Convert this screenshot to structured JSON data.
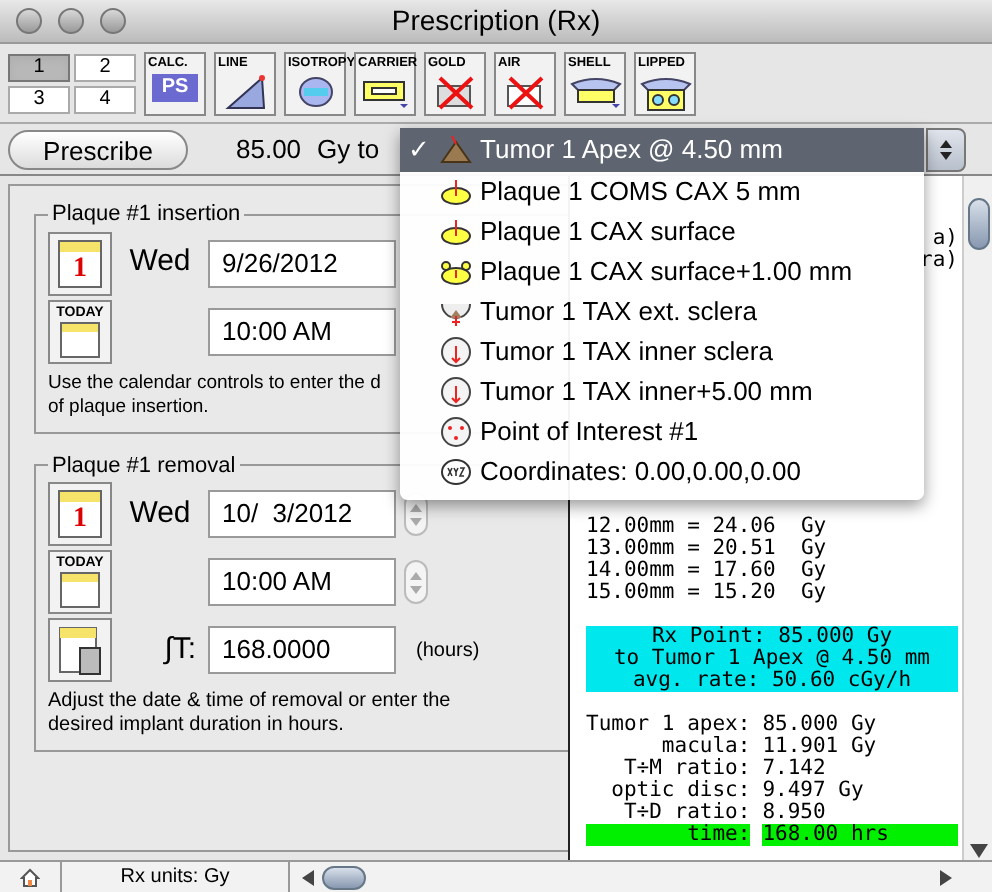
{
  "window": {
    "title": "Prescription (Rx)"
  },
  "toolbar": {
    "views": [
      {
        "label": "1",
        "selected": true
      },
      {
        "label": "2",
        "selected": false
      },
      {
        "label": "3",
        "selected": false
      },
      {
        "label": "4",
        "selected": false
      }
    ],
    "tools": [
      {
        "label": "CALC.",
        "kind": "calc",
        "badge": "PS"
      },
      {
        "label": "LINE",
        "kind": "line"
      },
      {
        "label": "ISOTROPY",
        "kind": "isotropy"
      },
      {
        "label": "CARRIER",
        "kind": "carrier"
      },
      {
        "label": "GOLD",
        "kind": "gold"
      },
      {
        "label": "AIR",
        "kind": "air"
      },
      {
        "label": "SHELL",
        "kind": "shell"
      },
      {
        "label": "LIPPED",
        "kind": "lipped"
      }
    ]
  },
  "prescribe": {
    "button": "Prescribe",
    "dose": "85.00",
    "unit": "Gy to",
    "check_mark": "✓",
    "menu": [
      {
        "label": "Tumor 1 Apex @ 4.50 mm",
        "kind": "tumor",
        "selected": true
      },
      {
        "label": "Plaque 1 COMS CAX 5 mm",
        "kind": "plaque",
        "selected": false
      },
      {
        "label": "Plaque 1 CAX surface",
        "kind": "plaque",
        "selected": false
      },
      {
        "label": "Plaque 1 CAX surface+1.00 mm",
        "kind": "plaque-ears",
        "selected": false
      },
      {
        "label": "Tumor 1 TAX ext. sclera",
        "kind": "sclera",
        "selected": false
      },
      {
        "label": "Tumor 1 TAX inner sclera",
        "kind": "inner",
        "selected": false
      },
      {
        "label": "Tumor 1 TAX inner+5.00 mm",
        "kind": "inner",
        "selected": false
      },
      {
        "label": "Point of Interest #1",
        "kind": "poi",
        "selected": false
      },
      {
        "label": "Coordinates: 0.00,0.00,0.00",
        "kind": "xyz",
        "selected": false
      }
    ]
  },
  "insertion": {
    "title": "Plaque #1 insertion",
    "day": "Wed",
    "date": "9/26/2012",
    "time": "10:00 AM",
    "today": "TODAY",
    "calendar_day": "1",
    "note": "Use the calendar controls to enter the d\nof plaque insertion."
  },
  "removal": {
    "title": "Plaque #1 removal",
    "day": "Wed",
    "date": "10/  3/2012",
    "time": "10:00 AM",
    "today": "TODAY",
    "calendar_day": "1",
    "jt_label": "∫T:",
    "duration": "168.0000",
    "duration_unit": "(hours)",
    "note": "Adjust the date & time of removal or enter the\ndesired implant duration in hours."
  },
  "report": {
    "fragments": [
      "a)",
      "ra)"
    ],
    "dose_lines": [
      "12.00mm = 24.06  Gy",
      "13.00mm = 20.51  Gy",
      "14.00mm = 17.60  Gy",
      "15.00mm = 15.20  Gy"
    ],
    "rx_block": [
      "Rx Point: 85.000 Gy",
      "to Tumor 1 Apex @ 4.50 mm",
      "avg. rate: 50.60 cGy/h"
    ],
    "summary": [
      {
        "label": "Tumor 1 apex:",
        "value": "85.000 Gy"
      },
      {
        "label": "macula:",
        "value": "11.901 Gy"
      },
      {
        "label": "T÷M ratio:",
        "value": "7.142"
      },
      {
        "label": "optic disc:",
        "value": "9.497 Gy"
      },
      {
        "label": "T÷D ratio:",
        "value": "8.950"
      }
    ],
    "time": {
      "label": "time:",
      "value": "168.00 hrs"
    }
  },
  "status_bar": {
    "units": "Rx units: Gy"
  }
}
